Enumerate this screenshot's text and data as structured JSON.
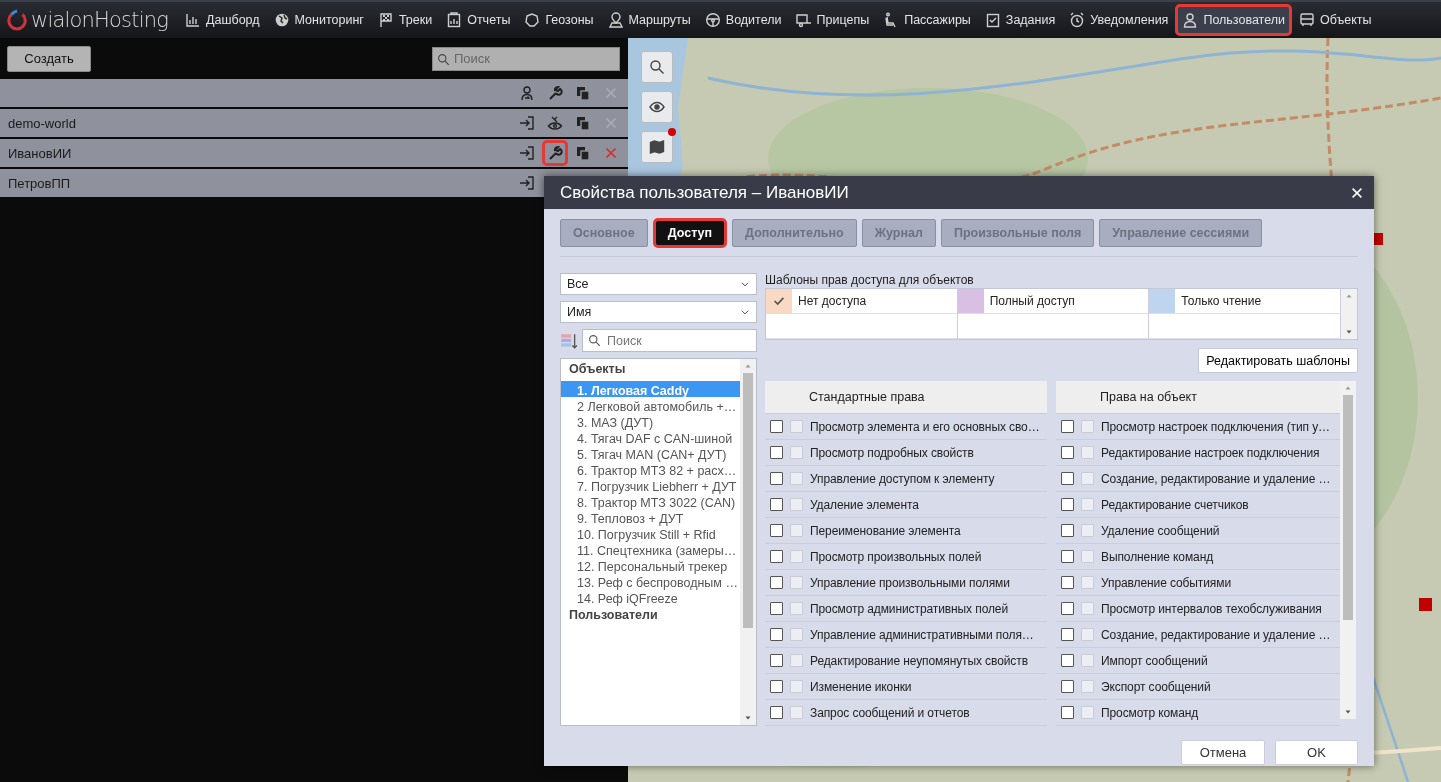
{
  "nav": {
    "logo": "wialonHosting",
    "items": [
      {
        "kind": "chart",
        "label": "Дашборд",
        "selected": false
      },
      {
        "kind": "globe",
        "label": "Мониторинг",
        "selected": false
      },
      {
        "kind": "flag",
        "label": "Треки",
        "selected": false
      },
      {
        "kind": "report",
        "label": "Отчеты",
        "selected": false
      },
      {
        "kind": "geofence",
        "label": "Геозоны",
        "selected": false
      },
      {
        "kind": "route",
        "label": "Маршруты",
        "selected": false
      },
      {
        "kind": "wheel",
        "label": "Водители",
        "selected": false
      },
      {
        "kind": "trailer",
        "label": "Прицепы",
        "selected": false
      },
      {
        "kind": "seat",
        "label": "Пассажиры",
        "selected": false
      },
      {
        "kind": "task",
        "label": "Задания",
        "selected": false
      },
      {
        "kind": "alarm",
        "label": "Уведомления",
        "selected": false
      },
      {
        "kind": "user",
        "label": "Пользователи",
        "selected": true
      },
      {
        "kind": "bus",
        "label": "Объекты",
        "selected": false
      }
    ]
  },
  "users_panel": {
    "create_button": "Создать",
    "search": {
      "placeholder": "Поиск"
    },
    "header_actions": [
      {
        "kind": "user",
        "disabled": false,
        "highlighted": false
      },
      {
        "kind": "wrench",
        "disabled": false,
        "highlighted": false
      },
      {
        "kind": "copy",
        "disabled": false,
        "highlighted": false
      },
      {
        "kind": "delete",
        "disabled": true,
        "highlighted": false
      }
    ],
    "rows": [
      {
        "name": "demo-world",
        "actions": [
          {
            "kind": "login",
            "disabled": false,
            "highlighted": false
          },
          {
            "kind": "eye-wrench",
            "disabled": false,
            "highlighted": false
          },
          {
            "kind": "copy",
            "disabled": false,
            "highlighted": false
          },
          {
            "kind": "delete",
            "disabled": true,
            "highlighted": false
          }
        ]
      },
      {
        "name": "ИвановИИ",
        "actions": [
          {
            "kind": "login",
            "disabled": false,
            "highlighted": false
          },
          {
            "kind": "wrench",
            "disabled": false,
            "highlighted": true
          },
          {
            "kind": "copy",
            "disabled": false,
            "highlighted": false
          },
          {
            "kind": "delete",
            "disabled": false,
            "highlighted": false
          }
        ]
      },
      {
        "name": "ПетровПП",
        "actions": [
          {
            "kind": "login",
            "disabled": false,
            "highlighted": false
          }
        ]
      }
    ]
  },
  "map": {
    "kind": "picture",
    "tools": [
      {
        "kind": "search"
      },
      {
        "kind": "eye"
      },
      {
        "kind": "layers",
        "badge": true
      }
    ]
  },
  "dialog": {
    "title": "Свойства пользователя – ИвановИИ",
    "tabs": [
      {
        "label": "Основное",
        "selected": false
      },
      {
        "label": "Доступ",
        "selected": true
      },
      {
        "label": "Дополнительно",
        "selected": false
      },
      {
        "label": "Журнал",
        "selected": false
      },
      {
        "label": "Произвольные поля",
        "selected": false
      },
      {
        "label": "Управление сессиями",
        "selected": false
      }
    ],
    "filter": "Все",
    "sort": "Имя",
    "search": {
      "placeholder": "Поиск"
    },
    "items": [
      {
        "kind": "group",
        "label": "Объекты"
      },
      {
        "kind": "item",
        "label": "1. Легковая Caddy",
        "selected": true
      },
      {
        "kind": "item",
        "label": "2 Легковой автомобиль +…",
        "selected": false
      },
      {
        "kind": "item",
        "label": "3. МАЗ (ДУТ)",
        "selected": false
      },
      {
        "kind": "item",
        "label": "4. Тягач DAF с CAN-шиной",
        "selected": false
      },
      {
        "kind": "item",
        "label": "5. Тягач MAN (CAN+ ДУТ)",
        "selected": false
      },
      {
        "kind": "item",
        "label": "6. Трактор МТЗ 82 + расх…",
        "selected": false
      },
      {
        "kind": "item",
        "label": "7. Погрузчик Liebherr + ДУТ",
        "selected": false
      },
      {
        "kind": "item",
        "label": "8. Трактор МТЗ 3022 (CAN)",
        "selected": false
      },
      {
        "kind": "item",
        "label": "9. Тепловоз + ДУТ",
        "selected": false
      },
      {
        "kind": "item",
        "label": "10. Погрузчик Still + Rfid",
        "selected": false
      },
      {
        "kind": "item",
        "label": "11. Спецтехника (замеры…",
        "selected": false
      },
      {
        "kind": "item",
        "label": "12. Персональный трекер",
        "selected": false
      },
      {
        "kind": "item",
        "label": "13. Реф с беспроводным …",
        "selected": false
      },
      {
        "kind": "item",
        "label": "14. Реф iQFreeze",
        "selected": false
      },
      {
        "kind": "group",
        "label": "Пользователи"
      }
    ],
    "templates_title": "Шаблоны прав доступа для объектов",
    "templates": [
      {
        "label": "Нет доступа",
        "color": "#f8d9c4",
        "checked": true
      },
      {
        "label": "Полный доступ",
        "color": "#d9bfe3",
        "checked": false
      },
      {
        "label": "Только чтение",
        "color": "#bfd4ef",
        "checked": false
      }
    ],
    "edit_templates_button": "Редактировать шаблоны",
    "standard": {
      "title": "Стандартные права",
      "rights": [
        {
          "label": "Просмотр элемента и его основных сво…",
          "checked": false,
          "extra_checked": false
        },
        {
          "label": "Просмотр подробных свойств",
          "checked": false,
          "extra_checked": false
        },
        {
          "label": "Управление доступом к элементу",
          "checked": false,
          "extra_checked": false
        },
        {
          "label": "Удаление элемента",
          "checked": false,
          "extra_checked": false
        },
        {
          "label": "Переименование элемента",
          "checked": false,
          "extra_checked": false
        },
        {
          "label": "Просмотр произвольных полей",
          "checked": false,
          "extra_checked": false
        },
        {
          "label": "Управление произвольными полями",
          "checked": false,
          "extra_checked": false
        },
        {
          "label": "Просмотр административных полей",
          "checked": false,
          "extra_checked": false
        },
        {
          "label": "Управление административными поля…",
          "checked": false,
          "extra_checked": false
        },
        {
          "label": "Редактирование неупомянутых свойств",
          "checked": false,
          "extra_checked": false
        },
        {
          "label": "Изменение иконки",
          "checked": false,
          "extra_checked": false
        },
        {
          "label": "Запрос сообщений и отчетов",
          "checked": false,
          "extra_checked": false
        }
      ]
    },
    "object": {
      "title": "Права на объект",
      "rights": [
        {
          "label": "Просмотр настроек подключения (тип у…",
          "checked": false,
          "extra_checked": false
        },
        {
          "label": "Редактирование настроек подключения",
          "checked": false,
          "extra_checked": false
        },
        {
          "label": "Создание, редактирование и удаление …",
          "checked": false,
          "extra_checked": false
        },
        {
          "label": "Редактирование счетчиков",
          "checked": false,
          "extra_checked": false
        },
        {
          "label": "Удаление сообщений",
          "checked": false,
          "extra_checked": false
        },
        {
          "label": "Выполнение команд",
          "checked": false,
          "extra_checked": false
        },
        {
          "label": "Управление событиями",
          "checked": false,
          "extra_checked": false
        },
        {
          "label": "Просмотр интервалов техобслуживания",
          "checked": false,
          "extra_checked": false
        },
        {
          "label": "Создание, редактирование и удаление …",
          "checked": false,
          "extra_checked": false
        },
        {
          "label": "Импорт сообщений",
          "checked": false,
          "extra_checked": false
        },
        {
          "label": "Экспорт сообщений",
          "checked": false,
          "extra_checked": false
        },
        {
          "label": "Просмотр команд",
          "checked": false,
          "extra_checked": false
        }
      ]
    },
    "buttons": [
      "Отмена",
      "OK"
    ]
  }
}
